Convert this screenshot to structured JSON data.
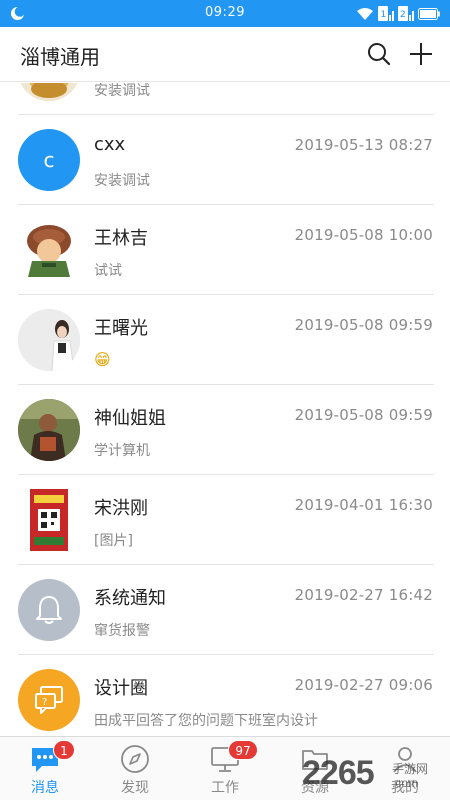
{
  "status_bar": {
    "time": "09:29"
  },
  "header": {
    "title": "淄博通用"
  },
  "conversations": [
    {
      "name": "",
      "time": "",
      "preview": "安装调试",
      "avatar_initial": ""
    },
    {
      "name": "cxx",
      "time": "2019-05-13 08:27",
      "preview": "安装调试",
      "avatar_initial": "c"
    },
    {
      "name": "王林吉",
      "time": "2019-05-08 10:00",
      "preview": "试试",
      "avatar_initial": ""
    },
    {
      "name": "王曙光",
      "time": "2019-05-08 09:59",
      "preview": "😁",
      "avatar_initial": ""
    },
    {
      "name": "神仙姐姐",
      "time": "2019-05-08 09:59",
      "preview": "学计算机",
      "avatar_initial": ""
    },
    {
      "name": "宋洪刚",
      "time": "2019-04-01 16:30",
      "preview": "[图片]",
      "avatar_initial": ""
    },
    {
      "name": "系统通知",
      "time": "2019-02-27 16:42",
      "preview": "窜货报警",
      "avatar_initial": ""
    },
    {
      "name": "设计圈",
      "time": "2019-02-27 09:06",
      "preview": "田成平回答了您的问题下班室内设计",
      "avatar_initial": ""
    }
  ],
  "tabbar": {
    "tabs": [
      {
        "label": "消息",
        "badge": "1"
      },
      {
        "label": "发现",
        "badge": ""
      },
      {
        "label": "工作",
        "badge": "97"
      },
      {
        "label": "资源",
        "badge": ""
      },
      {
        "label": "我的",
        "badge": ""
      }
    ]
  },
  "watermark": {
    "brand": "2265",
    "suffix": ".com",
    "tagline": "手游网"
  },
  "colors": {
    "primary": "#2196f3",
    "badge": "#e53935",
    "system_avatar": "#b6bec9",
    "design_avatar": "#f5a623",
    "text_secondary": "#8a8a8a"
  }
}
